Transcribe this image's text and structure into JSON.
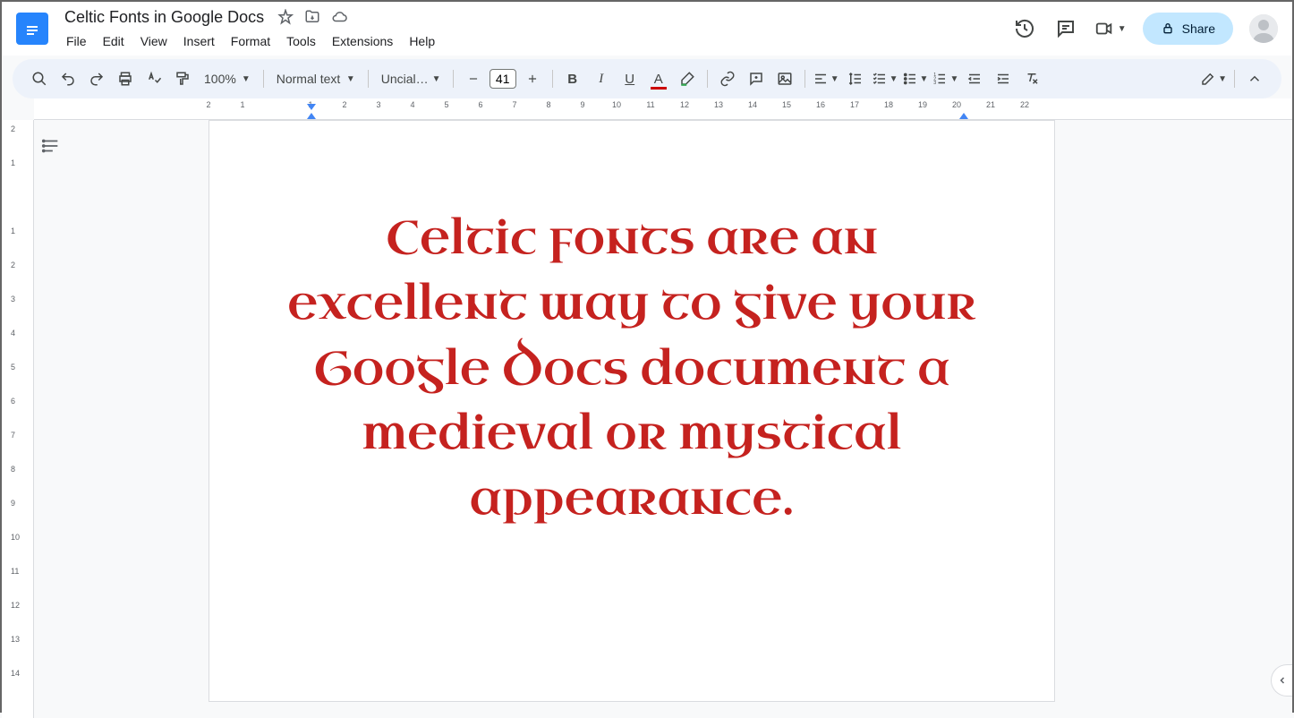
{
  "header": {
    "title": "Celtic Fonts in Google Docs",
    "menus": [
      "File",
      "Edit",
      "View",
      "Insert",
      "Format",
      "Tools",
      "Extensions",
      "Help"
    ],
    "share_label": "Share"
  },
  "toolbar": {
    "zoom": "100%",
    "style": "Normal text",
    "font": "Uncial…",
    "font_size": "41",
    "text_color": "#cc0000"
  },
  "ruler": {
    "h_numbers": [
      "2",
      "1",
      "",
      "1",
      "2",
      "3",
      "4",
      "5",
      "6",
      "7",
      "8",
      "9",
      "10",
      "11",
      "12",
      "13",
      "14",
      "15",
      "16",
      "17",
      "18",
      "19",
      "20",
      "21",
      "22"
    ],
    "v_numbers": [
      "2",
      "1",
      "",
      "1",
      "2",
      "3",
      "4",
      "5",
      "6",
      "7",
      "8",
      "9",
      "10",
      "11",
      "12",
      "13",
      "14"
    ]
  },
  "document": {
    "body_text": "Celtic fonts are an excellent way to give your Google Docs document a medieval or mystical appearance."
  }
}
